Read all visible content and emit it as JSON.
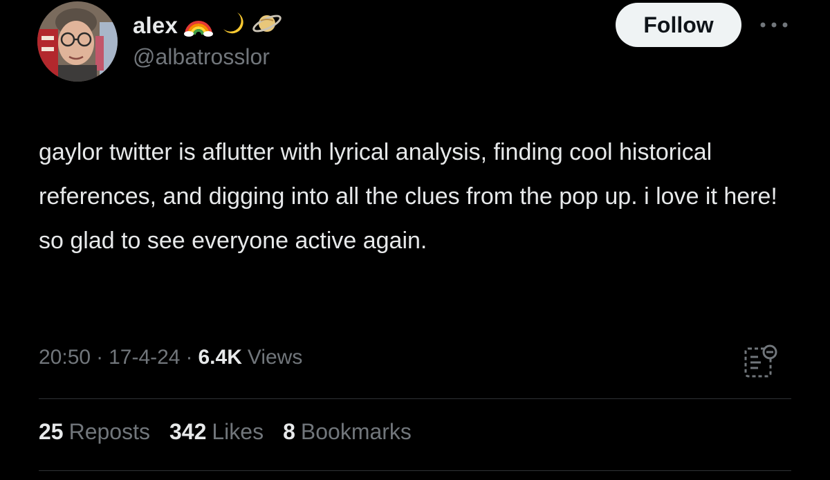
{
  "user": {
    "display_name": "alex",
    "handle": "@albatrosslor",
    "name_emojis": [
      "rainbow-emoji",
      "crescent-moon-emoji",
      "ringed-planet-emoji"
    ]
  },
  "follow_button": {
    "label": "Follow"
  },
  "tweet": {
    "text": "gaylor twitter is aflutter with lyrical analysis, finding cool historical references, and digging into all the clues from the pop up. i love it here! so glad to see everyone active again."
  },
  "meta": {
    "time": "20:50",
    "date": "17-4-24",
    "views_count": "6.4K",
    "views_label": "Views",
    "separator": "·"
  },
  "stats": {
    "reposts_count": "25",
    "reposts_label": "Reposts",
    "likes_count": "342",
    "likes_label": "Likes",
    "bookmarks_count": "8",
    "bookmarks_label": "Bookmarks"
  },
  "icons": [
    "more-options-icon",
    "post-analytics-icon"
  ],
  "colors": {
    "background": "#000000",
    "primary_text": "#e7e9ea",
    "secondary_text": "#71767b",
    "follow_bg": "#eff3f4",
    "follow_text": "#0f1419",
    "divider": "#2f3336"
  }
}
